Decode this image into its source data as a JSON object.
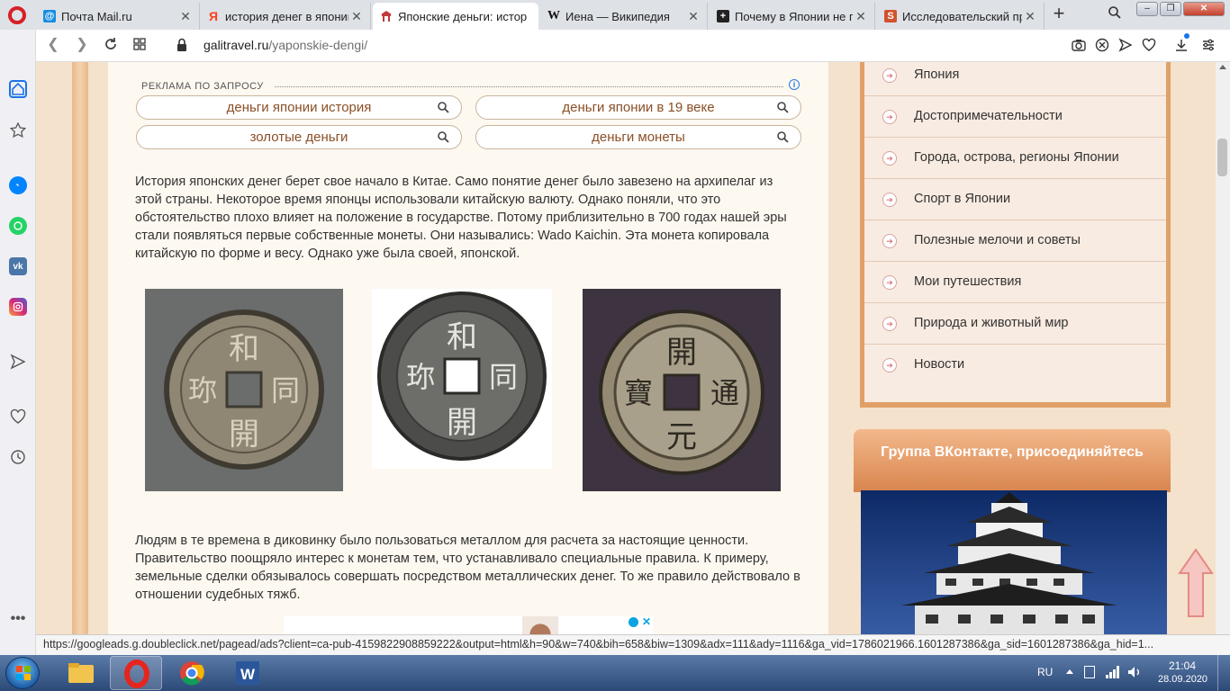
{
  "browser": {
    "tabs": [
      {
        "title": "Почта Mail.ru",
        "fav_color": "#168de2",
        "fav_char": "@"
      },
      {
        "title": "история денег в японии",
        "fav_color": "#fc3f1d",
        "fav_char": "Я"
      },
      {
        "title": "Японские деньги: истор",
        "fav_color": "#c23a3a",
        "fav_char": "J"
      },
      {
        "title": "Иена — Википедия",
        "fav_color": "#ffffff",
        "fav_char": "W"
      },
      {
        "title": "Почему в Японии не пр",
        "fav_color": "#222222",
        "fav_char": "+"
      },
      {
        "title": "Исследовательский прс",
        "fav_color": "#d2522d",
        "fav_char": "S"
      }
    ],
    "close_glyph": "✕",
    "new_tab": "+",
    "url_host": "galitravel.ru",
    "url_path": "/yaponskie-dengi/"
  },
  "page": {
    "ads_title": "РЕКЛАМА ПО ЗАПРОСУ",
    "ads_info": "i",
    "ads": [
      "деньги японии история",
      "деньги японии в 19 веке",
      "золотые деньги",
      "деньги монеты"
    ],
    "paragraph1": "История японских денег берет свое начало в Китае. Само понятие денег было завезено на архипелаг из этой страны. Некоторое время японцы использовали китайскую валюту. Однако поняли, что это обстоятельство плохо влияет на положение в государстве. Потому приблизительно в 700 годах нашей эры стали появляться первые собственные монеты. Они назывались: Wado Kaichin. Эта монета копировала китайскую по форме и весу. Однако уже была своей, японской.",
    "paragraph2": "Людям в те времена в диковинку было пользоваться металлом для расчета за настоящие ценности. Правительство поощряло интерес к монетам тем, что устанавливало специальные правила. К примеру, земельные сделки обязывалось совершать посредством металлических денег. То же правило действовало в отношении судебных тяжб.",
    "coin1_chars": [
      "和",
      "同",
      "開",
      "珎"
    ],
    "coin3_chars": [
      "開",
      "通",
      "元",
      "寶"
    ],
    "menu": [
      "Япония",
      "Достопримечательности",
      "Города, острова, регионы Японии",
      "Спорт в Японии",
      "Полезные мелочи и советы",
      "Мои путешествия",
      "Природа и животный мир",
      "Новости"
    ],
    "vk_title": "Группа ВКонтакте, присоединяйтесь"
  },
  "status_url": "https://googleads.g.doubleclick.net/pagead/ads?client=ca-pub-4159822908859222&output=html&h=90&w=740&bih=658&biw=1309&adx=111&ady=1116&ga_vid=1786021966.1601287386&ga_sid=1601287386&ga_hid=1...",
  "taskbar": {
    "lang": "RU",
    "time": "21:04",
    "date": "28.09.2020"
  },
  "colors": {
    "accent": "#e0a068",
    "link_brown": "#8b4f26"
  }
}
